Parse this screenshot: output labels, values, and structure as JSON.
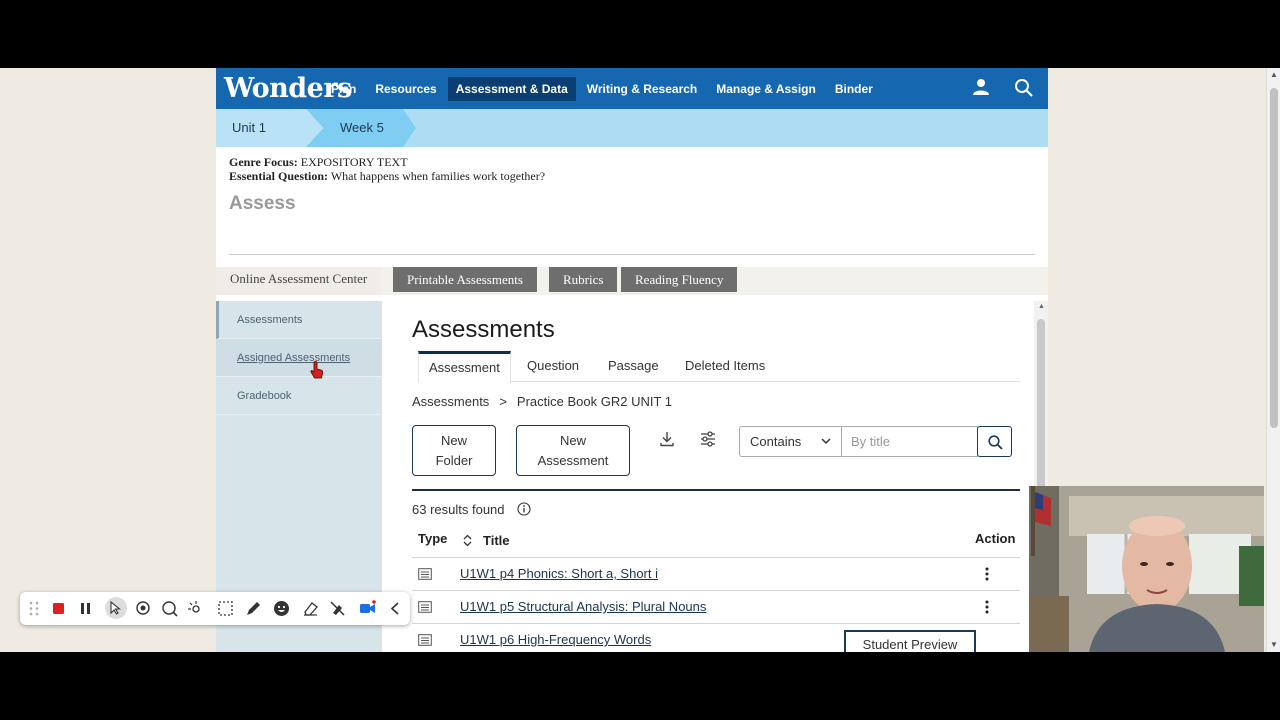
{
  "app": {
    "logo": "Wonders",
    "nav": [
      "Plan",
      "Resources",
      "Assessment & Data",
      "Writing & Research",
      "Manage & Assign",
      "Binder"
    ],
    "active_nav": "Assessment & Data"
  },
  "breadcrumb": {
    "unit": "Unit 1",
    "week": "Week 5"
  },
  "intro": {
    "genre_label": "Genre Focus:",
    "genre_value": "EXPOSITORY TEXT",
    "question_label": "Essential Question:",
    "question_value": "What happens when families work together?",
    "heading": "Assess"
  },
  "assess_tabs": [
    "Online Assessment Center",
    "Printable Assessments",
    "Rubrics",
    "Reading Fluency"
  ],
  "left_panel": [
    "Assessments",
    "Assigned Assessments",
    "Gradebook"
  ],
  "main": {
    "title": "Assessments",
    "subtabs": [
      "Assessment",
      "Question",
      "Passage",
      "Deleted Items"
    ],
    "path": {
      "root": "Assessments",
      "sep": ">",
      "current": "Practice Book GR2 UNIT 1"
    },
    "new_folder": [
      "New",
      "Folder"
    ],
    "new_assessment": [
      "New",
      "Assessment"
    ],
    "filter": {
      "contains": "Contains",
      "placeholder": "By title"
    },
    "results": "63 results found",
    "columns": {
      "type": "Type",
      "title": "Title",
      "action": "Action"
    },
    "rows": [
      {
        "title": "U1W1 p4 Phonics: Short a, Short i"
      },
      {
        "title": "U1W1 p5 Structural Analysis: Plural Nouns"
      },
      {
        "title": "U1W1 p6 High-Frequency Words"
      }
    ],
    "student_preview": "Student Preview"
  },
  "colors": {
    "nav_blue": "#1568b0",
    "nav_active": "#0b3f72",
    "crumb_blue": "#aedcf3",
    "tab_gray": "#6e6e6e",
    "panel_bg": "#d7e4ea"
  }
}
